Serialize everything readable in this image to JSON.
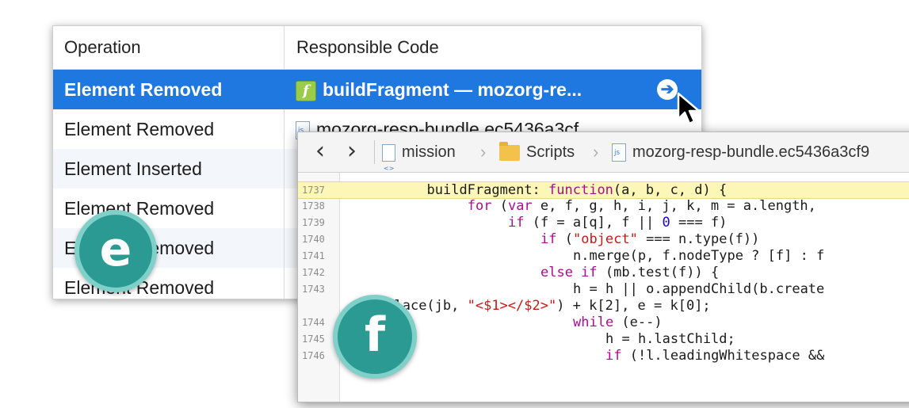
{
  "ops_table": {
    "headers": {
      "operation": "Operation",
      "responsible_code": "Responsible Code"
    },
    "rows": [
      {
        "operation": "Element Removed",
        "code": "buildFragment — mozorg-re...",
        "code_icon": "function-icon",
        "selected": true
      },
      {
        "operation": "Element Removed",
        "code": "mozorg-resp-bundle.ec5436a3cf",
        "code_icon": "js-file-icon",
        "selected": false
      },
      {
        "operation": "Element Inserted",
        "code": "",
        "selected": false
      },
      {
        "operation": "Element Removed",
        "code": "",
        "selected": false
      },
      {
        "operation": "Element Removed",
        "code": "",
        "selected": false
      },
      {
        "operation": "Element Removed",
        "code": "",
        "selected": false
      }
    ],
    "goto_icon": "arrow-circle-right-icon",
    "colors": {
      "selection": "#1e78e0",
      "function_icon": "#9acc4a"
    }
  },
  "editor": {
    "nav": {
      "back": "‹",
      "forward": "›"
    },
    "breadcrumbs": [
      {
        "label": "mission",
        "icon": "resource-icon"
      },
      {
        "label": "Scripts",
        "icon": "folder-icon"
      },
      {
        "label": "mozorg-resp-bundle.ec5436a3cf9",
        "icon": "js-file-icon"
      }
    ],
    "lines": [
      {
        "no": "1737",
        "highlight": true,
        "tokens": [
          [
            "plain",
            "buildFragment: "
          ],
          [
            "kw",
            "function"
          ],
          [
            "plain",
            "(a, b, c, d) {"
          ]
        ],
        "indent": 10
      },
      {
        "no": "1738",
        "highlight": false,
        "tokens": [
          [
            "kw",
            "for"
          ],
          [
            "plain",
            " ("
          ],
          [
            "kw",
            "var"
          ],
          [
            "plain",
            " e, f, g, h, i, j, k, m = a.length,"
          ]
        ],
        "indent": 15
      },
      {
        "no": "1739",
        "highlight": false,
        "tokens": [
          [
            "kw",
            "if"
          ],
          [
            "plain",
            " (f = a[q], f || "
          ],
          [
            "num",
            "0"
          ],
          [
            "plain",
            " === f)"
          ]
        ],
        "indent": 20
      },
      {
        "no": "1740",
        "highlight": false,
        "tokens": [
          [
            "kw",
            "if"
          ],
          [
            "plain",
            " ("
          ],
          [
            "str",
            "\"object\""
          ],
          [
            "plain",
            " === n.type(f))"
          ]
        ],
        "indent": 24
      },
      {
        "no": "1741",
        "highlight": false,
        "tokens": [
          [
            "plain",
            "n.merge(p, f.nodeType ? [f] : f"
          ]
        ],
        "indent": 28
      },
      {
        "no": "1742",
        "highlight": false,
        "tokens": [
          [
            "kw",
            "else if"
          ],
          [
            "plain",
            " (mb.test(f)) {"
          ]
        ],
        "indent": 24
      },
      {
        "no": "1743",
        "highlight": false,
        "tokens": [
          [
            "plain",
            "h = h || o.appendChild(b.create"
          ]
        ],
        "indent": 28
      },
      {
        "no": "",
        "highlight": false,
        "tokens": [
          [
            "plain",
            "place(jb, "
          ],
          [
            "str",
            "\"<$1></$2>\""
          ],
          [
            "plain",
            ") + k[2], e = k[0];"
          ]
        ],
        "indent": 5
      },
      {
        "no": "1744",
        "highlight": false,
        "tokens": [
          [
            "kw",
            "while"
          ],
          [
            "plain",
            " (e--)"
          ]
        ],
        "indent": 28
      },
      {
        "no": "1745",
        "highlight": false,
        "tokens": [
          [
            "plain",
            "h = h.lastChild;"
          ]
        ],
        "indent": 32
      },
      {
        "no": "1746",
        "highlight": false,
        "tokens": [
          [
            "kw",
            "if"
          ],
          [
            "plain",
            " (!l.leadingWhitespace &&"
          ]
        ],
        "indent": 32
      }
    ]
  },
  "badges": {
    "e": "e",
    "f": "f"
  },
  "colors": {
    "badge_fill": "#2a9a92",
    "badge_ring": "#7fd0c8",
    "highlight_line": "#fdf7b7"
  }
}
